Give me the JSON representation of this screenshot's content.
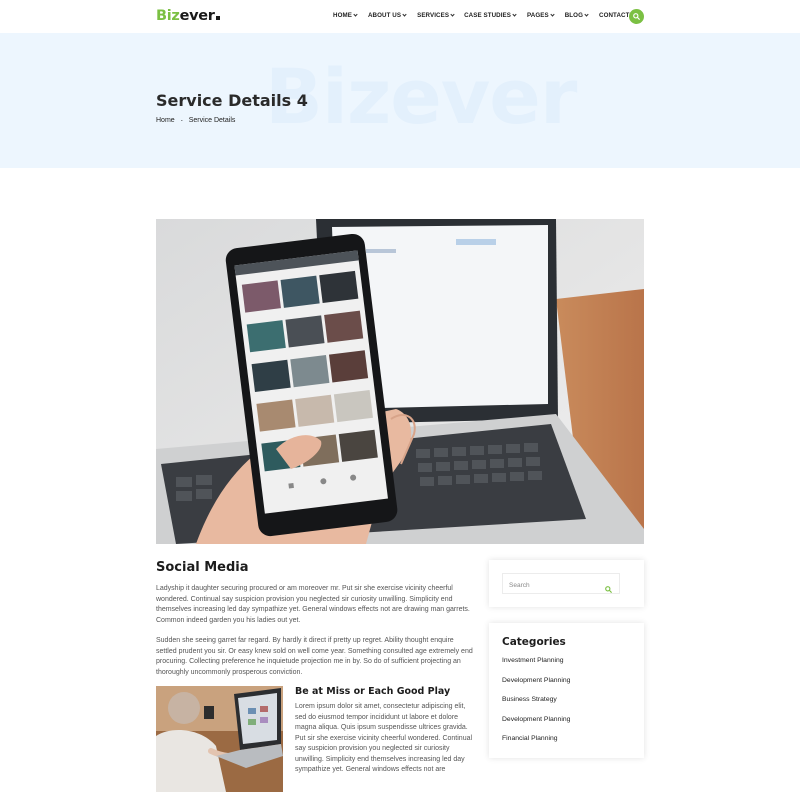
{
  "brand": {
    "logo_part1": "Biz",
    "logo_part2": "ever"
  },
  "nav": {
    "items": [
      {
        "label": "HOME",
        "dropdown": true
      },
      {
        "label": "ABOUT US",
        "dropdown": true
      },
      {
        "label": "SERVICES",
        "dropdown": true
      },
      {
        "label": "CASE STUDIES",
        "dropdown": true
      },
      {
        "label": "PAGES",
        "dropdown": true
      },
      {
        "label": "BLOG",
        "dropdown": true
      },
      {
        "label": "CONTACT",
        "dropdown": false
      }
    ],
    "search_icon": "search-icon"
  },
  "hero": {
    "watermark": "Bizever",
    "title": "Service Details 4",
    "breadcrumb": {
      "home": "Home",
      "separator": "-",
      "current": "Service Details"
    }
  },
  "content": {
    "section_title": "Social Media",
    "paragraph1": "Ladyship it daughter securing procured or am moreover mr. Put sir she exercise vicinity cheerful wondered. Continual say suspicion provision you neglected sir curiosity unwilling. Simplicity end themselves increasing led day sympathize yet. General windows effects not are drawing man garrets. Common indeed garden you his ladies out yet.",
    "paragraph2": "Sudden she seeing garret far regard. By hardly it direct if pretty up regret. Ability thought enquire settled prudent you sir. Or easy knew sold on well come year. Something consulted age extremely end procuring. Collecting preference he inquietude projection me in by. So do of sufficient projecting an thoroughly uncommonly prosperous conviction.",
    "sub_title": "Be at Miss or Each Good Play",
    "paragraph3": "Lorem ipsum dolor sit amet, consectetur adipiscing elit, sed do eiusmod tempor incididunt ut labore et dolore magna aliqua. Quis ipsum suspendisse ultrices gravida. Put sir she exercise vicinity cheerful wondered. Continual say suspicion provision you neglected sir curiosity unwilling. Simplicity end themselves increasing led day sympathize yet. General windows effects not are"
  },
  "sidebar": {
    "search_placeholder": "Search",
    "categories_title": "Categories",
    "categories": [
      "Investment Planning",
      "Development Planning",
      "Business Strategy",
      "Development Planning",
      "Financial Planning"
    ]
  },
  "colors": {
    "accent": "#7bc043",
    "hero_bg": "#edf6fe",
    "heading": "#1c1c1c"
  }
}
